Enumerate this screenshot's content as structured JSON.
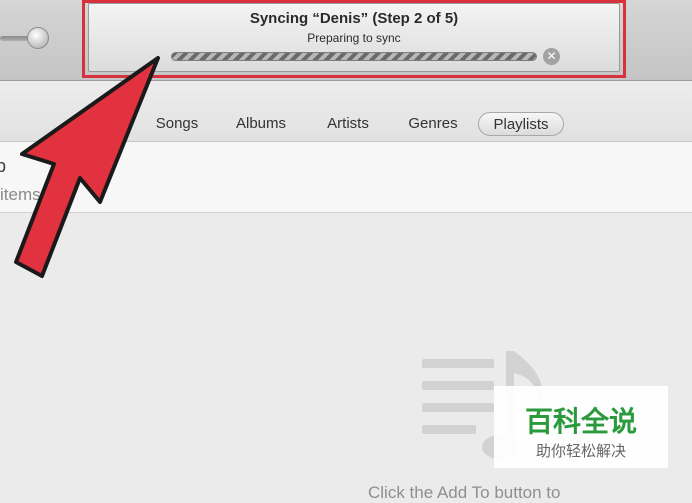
{
  "lcd": {
    "title": "Syncing “Denis” (Step 2 of 5)",
    "subtitle": "Preparing to sync",
    "cancel_glyph": "✕"
  },
  "tabs": [
    {
      "label": "Songs"
    },
    {
      "label": "Albums"
    },
    {
      "label": "Artists"
    },
    {
      "label": "Genres"
    },
    {
      "label": "Playlists",
      "selected": true
    }
  ],
  "header": {
    "name_fragment": "b",
    "count_fragment": "items"
  },
  "empty_state": {
    "hint": "Click the Add To button to"
  },
  "watermark": {
    "title": "百科全说",
    "subtitle": "助你轻松解决"
  },
  "colors": {
    "highlight": "#d6313d",
    "arrow_fill": "#e2313f",
    "watermark_green": "#2a9a3c"
  }
}
